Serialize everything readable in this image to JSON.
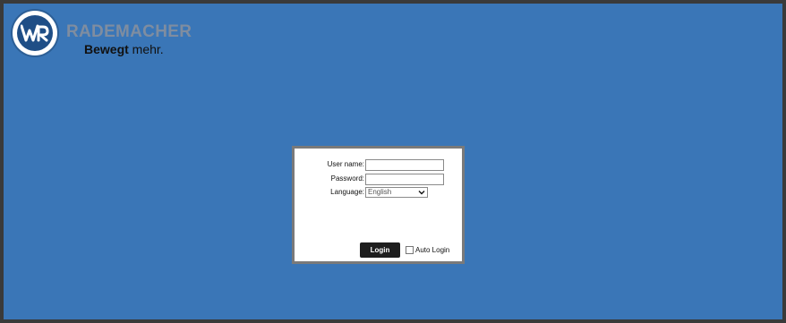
{
  "brand": {
    "name": "RADEMACHER",
    "tagline_bold": "Bewegt",
    "tagline_rest": " mehr."
  },
  "login_form": {
    "username_label": "User name:",
    "username_value": "",
    "password_label": "Password:",
    "password_value": "",
    "language_label": "Language:",
    "language_selected": "English",
    "login_button": "Login",
    "auto_login_label": "Auto Login",
    "auto_login_checked": false
  },
  "colors": {
    "background": "#3a76b7",
    "button": "#1e1e1e",
    "dialog_border": "#7a7a7a"
  },
  "icons": {
    "logo": "rademacher-logo",
    "select_arrow": "chevron-down-icon"
  }
}
